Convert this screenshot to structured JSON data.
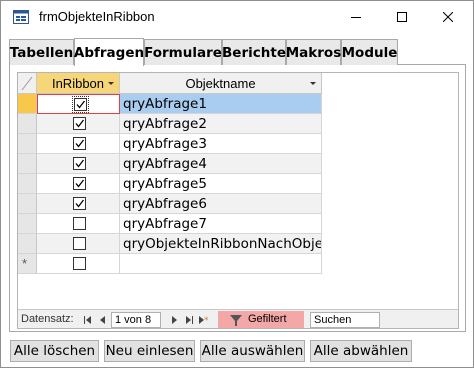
{
  "window": {
    "title": "frmObjekteInRibbon"
  },
  "tabs": [
    {
      "label": "Tabellen"
    },
    {
      "label": "Abfragen"
    },
    {
      "label": "Formulare"
    },
    {
      "label": "Berichte"
    },
    {
      "label": "Makros"
    },
    {
      "label": "Module"
    }
  ],
  "active_tab": "Abfragen",
  "table": {
    "columns": [
      "InRibbon",
      "Objektname"
    ],
    "rows": [
      {
        "checked": true,
        "name": "qryAbfrage1"
      },
      {
        "checked": true,
        "name": "qryAbfrage2"
      },
      {
        "checked": true,
        "name": "qryAbfrage3"
      },
      {
        "checked": true,
        "name": "qryAbfrage4"
      },
      {
        "checked": true,
        "name": "qryAbfrage5"
      },
      {
        "checked": true,
        "name": "qryAbfrage6"
      },
      {
        "checked": false,
        "name": "qryAbfrage7"
      },
      {
        "checked": false,
        "name": "qryObjekteInRibbonNachObjekt"
      }
    ],
    "new_row_marker": "*"
  },
  "navigation": {
    "label": "Datensatz:",
    "position": "1 von 8",
    "filter_label": "Gefiltert",
    "search_label": "Suchen"
  },
  "buttons": {
    "delete_all": "Alle löschen",
    "reload": "Neu einlesen",
    "select_all": "Alle auswählen",
    "deselect_all": "Alle abwählen"
  },
  "colors": {
    "header_active": "#f7d67a",
    "row_selected": "#a9cdf0",
    "filter_badge": "#f3a7a7"
  }
}
